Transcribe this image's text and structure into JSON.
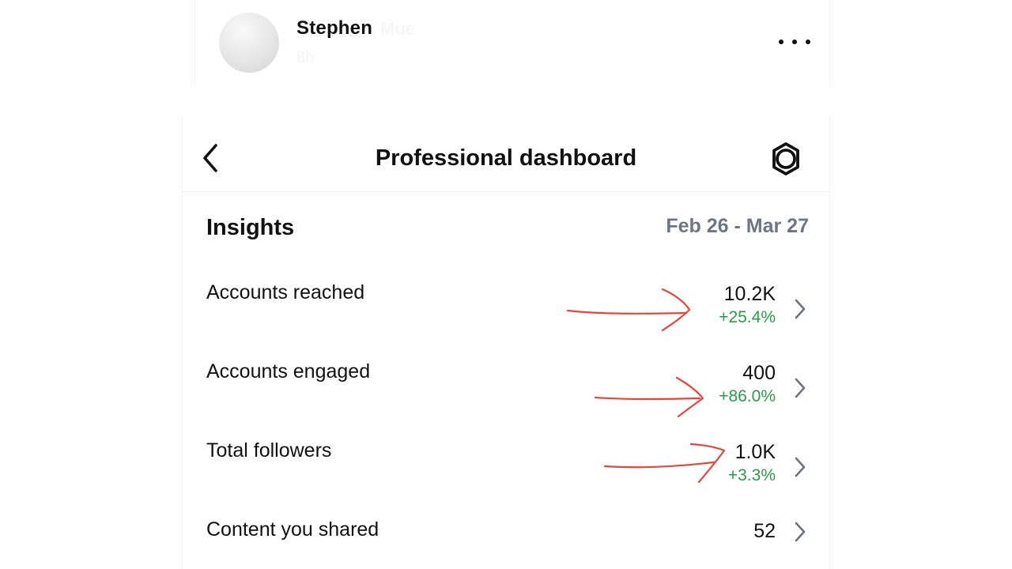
{
  "post": {
    "username": "Stephen",
    "username_faded": "Mue",
    "time": "8h",
    "more_icon": "more-horizontal-icon"
  },
  "header": {
    "title": "Professional dashboard",
    "back_icon": "chevron-left-icon",
    "settings_icon": "settings-gear-icon"
  },
  "insights": {
    "title": "Insights",
    "date_range": "Feb 26 - Mar 27",
    "metrics": [
      {
        "label": "Accounts reached",
        "value": "10.2K",
        "change": "+25.4%"
      },
      {
        "label": "Accounts engaged",
        "value": "400",
        "change": "+86.0%"
      },
      {
        "label": "Total followers",
        "value": "1.0K",
        "change": "+3.3%"
      },
      {
        "label": "Content you shared",
        "value": "52"
      }
    ]
  },
  "colors": {
    "positive_change": "#2a9a47",
    "date_range": "#6e7683",
    "annotation_arrow": "#e5453a",
    "chevron": "#6b7280"
  }
}
